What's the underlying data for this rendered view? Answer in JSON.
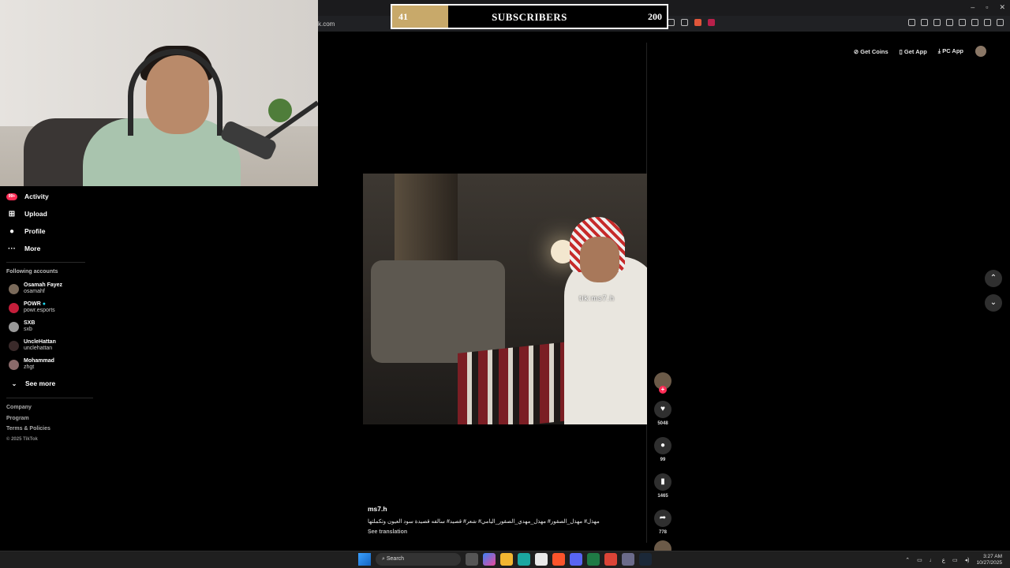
{
  "browser": {
    "address_text": "k.com",
    "window_controls": [
      "–",
      "▫",
      "✕"
    ]
  },
  "subscriber_goal": {
    "current": "41",
    "label": "SUBSCRIBERS",
    "goal": "200",
    "progress_fraction": 0.205,
    "fill_color": "#c8a96a"
  },
  "top_actions": {
    "get_coins": "Get Coins",
    "get_app": "Get App",
    "pc_app": "PC App"
  },
  "sidebar": {
    "nav": [
      {
        "label": "Activity",
        "icon": "activity-icon",
        "badge": "99+"
      },
      {
        "label": "Upload",
        "icon": "upload-icon"
      },
      {
        "label": "Profile",
        "icon": "profile-icon"
      },
      {
        "label": "More",
        "icon": "more-icon"
      }
    ],
    "following_title": "Following accounts",
    "following": [
      {
        "name": "Osamah Fayez",
        "handle": "osamahf"
      },
      {
        "name": "POWR",
        "handle": "powr.esports"
      },
      {
        "name": "SXB",
        "handle": "sxb"
      },
      {
        "name": "UncleHattan",
        "handle": "unclehattan"
      },
      {
        "name": "Mohammad",
        "handle": "zhgt"
      }
    ],
    "see_more": "See more",
    "footer": [
      "Company",
      "Program",
      "Terms & Policies",
      "© 2025 TikTok"
    ]
  },
  "video": {
    "watermark": "tik:ms7.h",
    "author": "ms7.h",
    "caption": "مهذل# مهذل_الصقور# مهذل_مهدي_الصقور_اليامي# شعر# قصيد# سالفه قصيدة سود العيون وتكملتها",
    "see_translation": "See translation"
  },
  "actions": {
    "likes": "5048",
    "comments": "99",
    "saves": "1465",
    "shares": "778"
  },
  "taskbar": {
    "search": "Search",
    "lang": "ع",
    "time": "3:27 AM",
    "date": "10/27/2025"
  }
}
